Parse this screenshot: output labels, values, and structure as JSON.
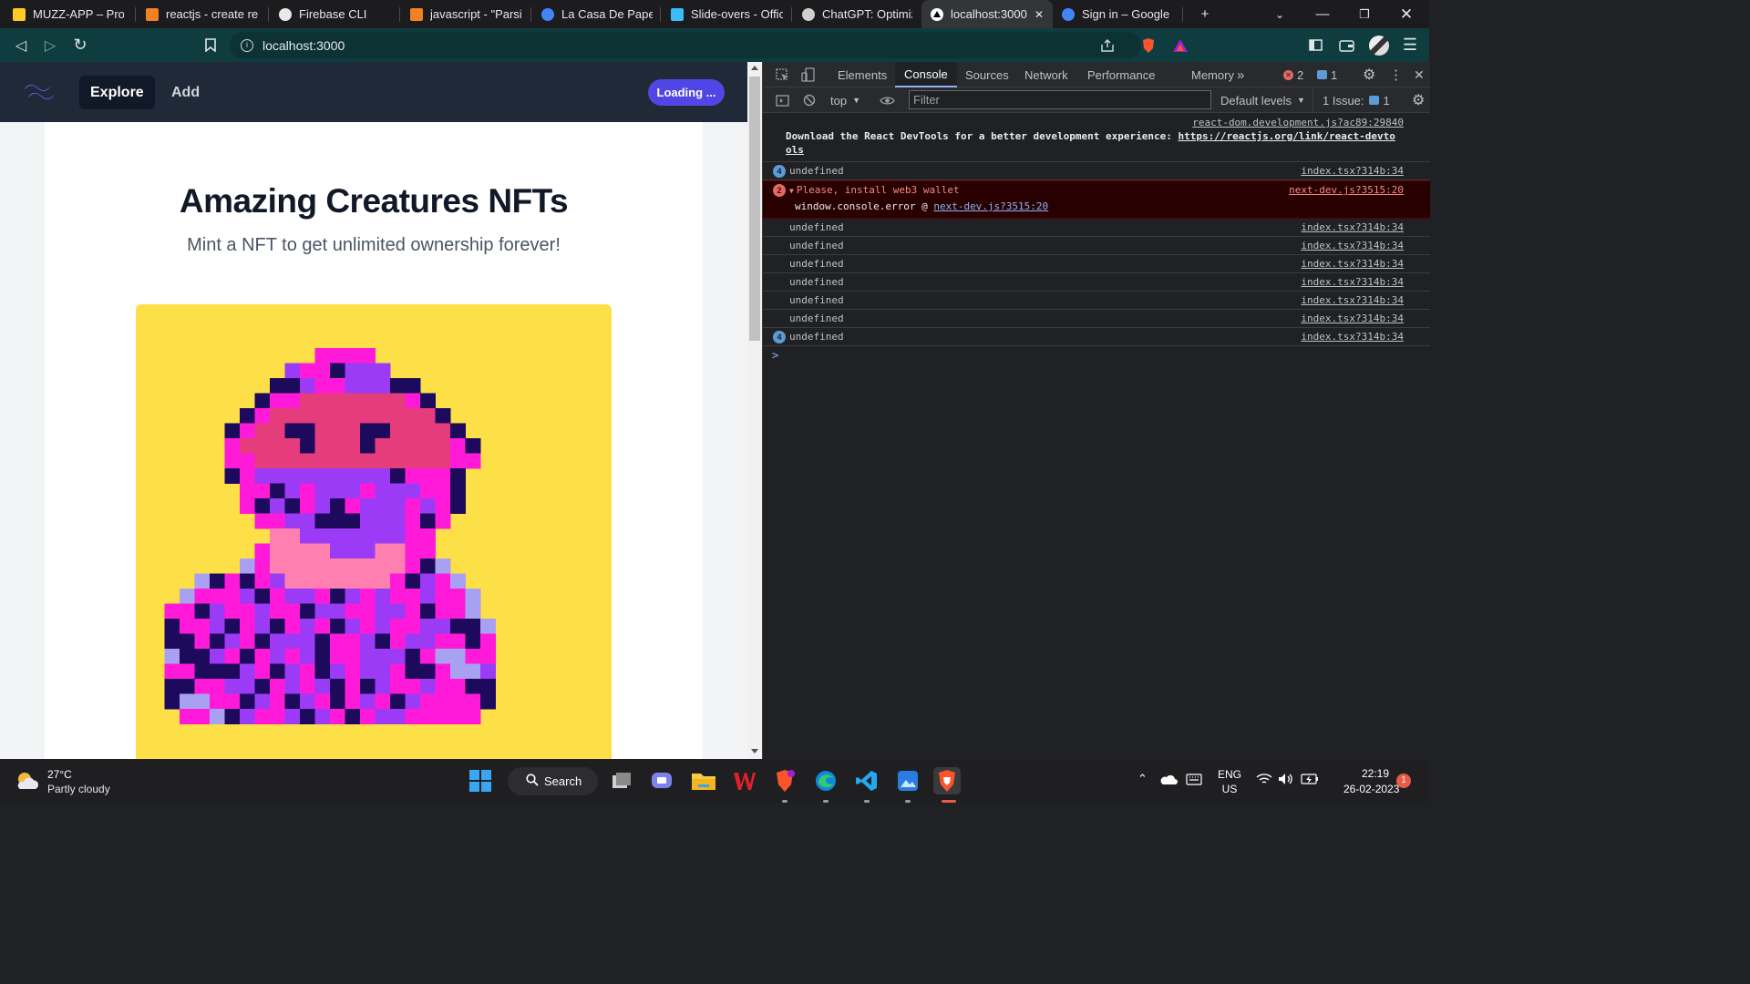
{
  "tabs": [
    {
      "title": "MUZZ-APP – Projec",
      "icon": "firebase-icon",
      "color": "#ffca28"
    },
    {
      "title": "reactjs - create reac",
      "icon": "stackoverflow-icon",
      "color": "#f48024"
    },
    {
      "title": "Firebase CLI",
      "icon": "globe-icon",
      "color": "#e8e8e8"
    },
    {
      "title": "javascript - \"Parsing",
      "icon": "stackoverflow-icon",
      "color": "#f48024"
    },
    {
      "title": "La Casa De Papel sc",
      "icon": "google-icon",
      "color": "#4285f4"
    },
    {
      "title": "Slide-overs - Officia",
      "icon": "tailwind-icon",
      "color": "#38bdf8"
    },
    {
      "title": "ChatGPT: Optimizin",
      "icon": "openai-icon",
      "color": "#cfcfcf"
    },
    {
      "title": "localhost:3000",
      "icon": "vercel-icon",
      "color": "#ffffff",
      "active": true
    },
    {
      "title": "Sign in – Google ac",
      "icon": "google-icon",
      "color": "#4285f4"
    }
  ],
  "address": {
    "url": "localhost:3000"
  },
  "app": {
    "nav": {
      "explore": "Explore",
      "add": "Add",
      "button": "Loading ..."
    },
    "title": "Amazing Creatures NFTs",
    "subtitle": "Mint a NFT to get unlimited ownership forever!"
  },
  "devtools": {
    "tabs": [
      "Elements",
      "Console",
      "Sources",
      "Network",
      "Performance",
      "Memory"
    ],
    "active_tab": "Console",
    "more": "»",
    "error_count": "2",
    "issue_count": "1",
    "context": "top",
    "filter_placeholder": "Filter",
    "levels": "Default levels",
    "issues_label": "1 Issue:",
    "issues_value": "1",
    "messages": {
      "react_src": "react-dom.development.js?ac89:29840",
      "react_text": "Download the React DevTools for a better experience:",
      "react_text_prefix": "Download the React DevTools for a better development experience: ",
      "react_link": "https://reactjs.org/link/react-devtools",
      "react_link_line1": "https://reactjs.org/link/react-devto",
      "react_link_line2": "ols",
      "undefined": "undefined",
      "index_src": "index.tsx?314b:34",
      "repeat4": "4",
      "error_count": "2",
      "error_text": "Please, install web3 wallet",
      "error_src": "next-dev.js?3515:20",
      "error_stack": "window.console.error",
      "error_stack_at": "@",
      "error_stack_link": "next-dev.js?3515:20",
      "prompt": ">"
    }
  },
  "taskbar": {
    "weather": {
      "temp": "27°C",
      "desc": "Partly cloudy"
    },
    "search": "Search",
    "lang": "ENG",
    "region": "US",
    "time": "22:19",
    "date": "26-02-2023",
    "notif_count": "1"
  }
}
